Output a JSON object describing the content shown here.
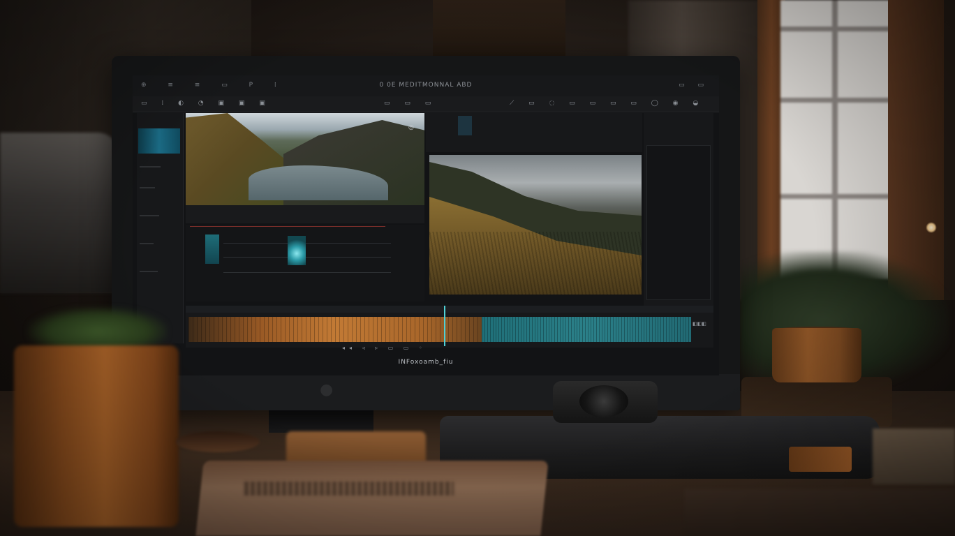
{
  "app": {
    "title": "0 0E MEDITMONNAL ABD",
    "bottom_label": "INFoxoamb_fiu"
  },
  "menubar": {
    "left_icons": "⊕ ≡ ≡ ▭ P ⁞",
    "right_icons": "▭ ▭"
  },
  "toolbar": {
    "group1": "▭ ⁞ ◐ ◔ ▣ ▣ ▣",
    "group2": "▭ ▭ ▭",
    "group3": "⟋ ▭ ◌ ▭ ▭ ▭ ▭ ◯ ◉ ◒"
  },
  "timeline": {
    "end_label": "◧◧◧"
  },
  "transport": {
    "icons": "◂◂ ◃ ▹ ▭ ▭ ◦"
  },
  "icons": {
    "apple_logo": "apple-logo-icon"
  }
}
